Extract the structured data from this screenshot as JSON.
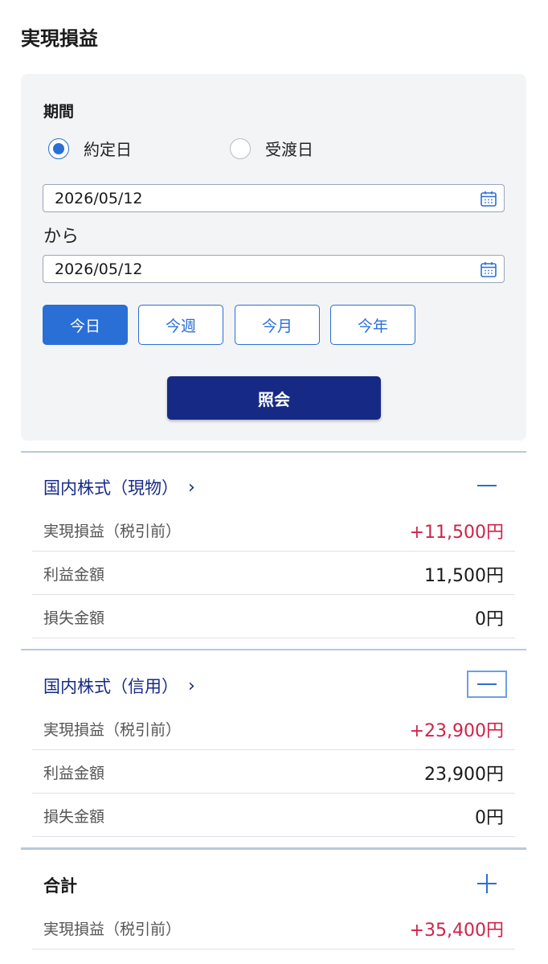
{
  "page": {
    "title": "実現損益"
  },
  "period": {
    "label": "期間",
    "radio_options": [
      {
        "label": "約定日",
        "checked": true
      },
      {
        "label": "受渡日",
        "checked": false
      }
    ],
    "from_date": "2026/05/12",
    "separator": "から",
    "to_date": "2026/05/12",
    "calendar_icon": "calendar-icon",
    "quick_buttons": [
      {
        "label": "今日",
        "active": true
      },
      {
        "label": "今週",
        "active": false
      },
      {
        "label": "今月",
        "active": false
      },
      {
        "label": "今年",
        "active": false
      }
    ],
    "search_label": "照会"
  },
  "sections": [
    {
      "title": "国内株式（現物）",
      "chevron": "›",
      "toggle_icon": "minus-icon",
      "rows": [
        {
          "label": "実現損益（税引前）",
          "value": "+11,500円",
          "highlight": true
        },
        {
          "label": "利益金額",
          "value": "11,500円",
          "highlight": false
        },
        {
          "label": "損失金額",
          "value": "0円",
          "highlight": false
        }
      ]
    },
    {
      "title": "国内株式（信用）",
      "chevron": "›",
      "toggle_icon": "minus-icon",
      "rows": [
        {
          "label": "実現損益（税引前）",
          "value": "+23,900円",
          "highlight": true
        },
        {
          "label": "利益金額",
          "value": "23,900円",
          "highlight": false
        },
        {
          "label": "損失金額",
          "value": "0円",
          "highlight": false
        }
      ]
    }
  ],
  "total": {
    "title": "合計",
    "toggle_icon": "plus-icon",
    "rows": [
      {
        "label": "実現損益（税引前）",
        "value": "+35,400円",
        "highlight": true
      }
    ]
  },
  "colors": {
    "accent": "#2a6fd6",
    "primary_dark": "#162a85",
    "profit": "#d0234a",
    "panel_bg": "#f3f4f6"
  }
}
